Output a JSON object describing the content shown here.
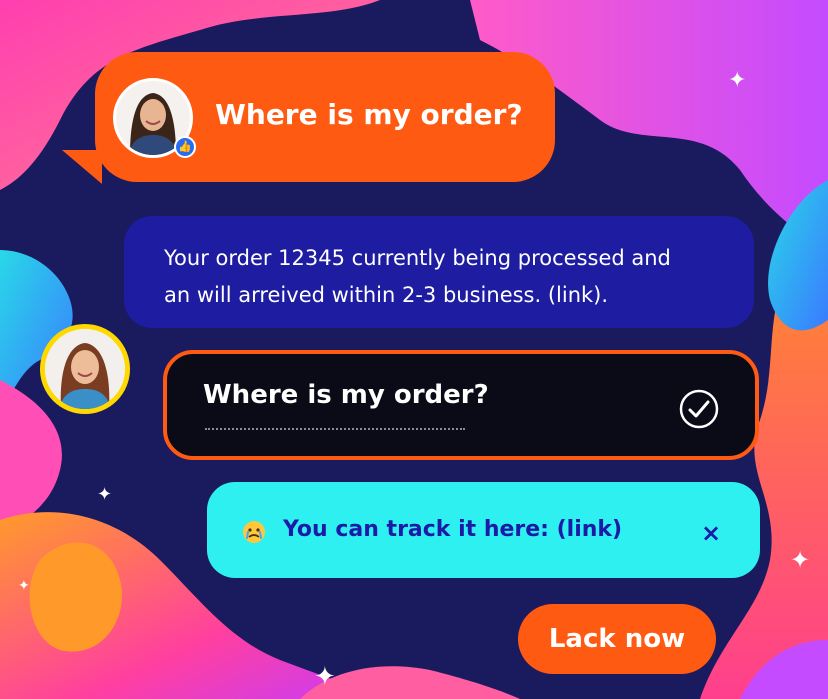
{
  "messages": [
    {
      "id": "user-1",
      "text": "Where is my order?"
    },
    {
      "id": "bot-1",
      "lines": [
        "Your order 12345 currently being processed and",
        "an will arreived within 2-3 business. (link)."
      ]
    },
    {
      "id": "user-2",
      "text": "Where is my order?"
    },
    {
      "id": "bot-2",
      "text": "You can track it here: (link)"
    }
  ],
  "actions": {
    "close_label": "×",
    "track_label": "Lack now"
  },
  "icons": {
    "check": "check-circle-icon",
    "emoji": "crying-emoji-icon",
    "badge": "thumbs-up-badge-icon",
    "close": "close-icon"
  },
  "colors": {
    "orange": "#ff5a12",
    "navy": "#1a1a5e",
    "blue_bubble": "#1e1ca0",
    "cyan": "#2ef0f0",
    "dark_bubble": "#0b0b18",
    "avatar_ring": "#ffd800"
  }
}
